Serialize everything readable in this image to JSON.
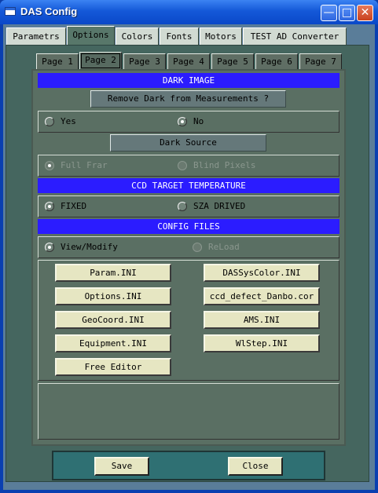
{
  "window": {
    "title": "DAS Config"
  },
  "tabs": [
    "Parametrs",
    "Options",
    "Colors",
    "Fonts",
    "Motors",
    "TEST AD Converter"
  ],
  "pages": [
    "Page 1",
    "Page 2",
    "Page 3",
    "Page 4",
    "Page 5",
    "Page 6",
    "Page 7"
  ],
  "dark_image": {
    "header": "DARK IMAGE",
    "remove_label": "Remove Dark from Measurements ?",
    "yes": "Yes",
    "no": "No",
    "source_label": "Dark Source",
    "full_frame": "Full Frar",
    "blind_pixels": "Blind Pixels"
  },
  "ccd": {
    "header": "CCD TARGET TEMPERATURE",
    "fixed": "FIXED",
    "sza": "SZA DRIVED"
  },
  "config": {
    "header": "CONFIG FILES",
    "view_modify": "View/Modify",
    "reload": "ReLoad",
    "files_left": [
      "Param.INI",
      "Options.INI",
      "GeoCoord.INI",
      "Equipment.INI",
      "Free Editor"
    ],
    "files_right": [
      "DASSysColor.INI",
      "ccd_defect_Danbo.cor",
      "AMS.INI",
      "WlStep.INI"
    ]
  },
  "actions": {
    "save": "Save",
    "close": "Close"
  }
}
